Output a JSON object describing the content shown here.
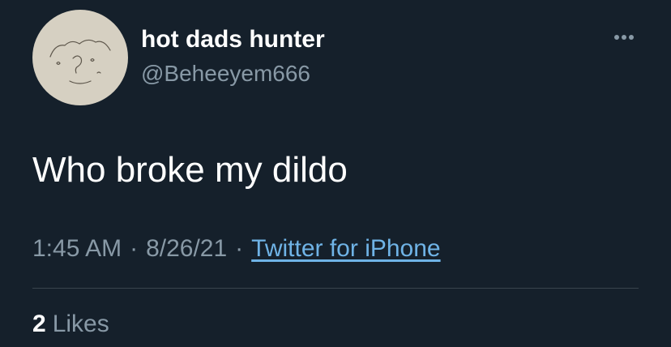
{
  "author": {
    "display_name": "hot dads hunter",
    "handle": "@Beheeyem666"
  },
  "tweet": {
    "text": "Who broke my dildo",
    "time": "1:45 AM",
    "date": "8/26/21",
    "separator": "·",
    "source": "Twitter for iPhone"
  },
  "stats": {
    "likes_count": "2",
    "likes_label": "Likes"
  },
  "icons": {
    "avatar": "doodle-face-avatar",
    "more": "more-horizontal-icon"
  },
  "colors": {
    "background": "#15202b",
    "secondary_text": "#8899a6",
    "link": "#6fb3e6",
    "divider": "#38444d"
  }
}
